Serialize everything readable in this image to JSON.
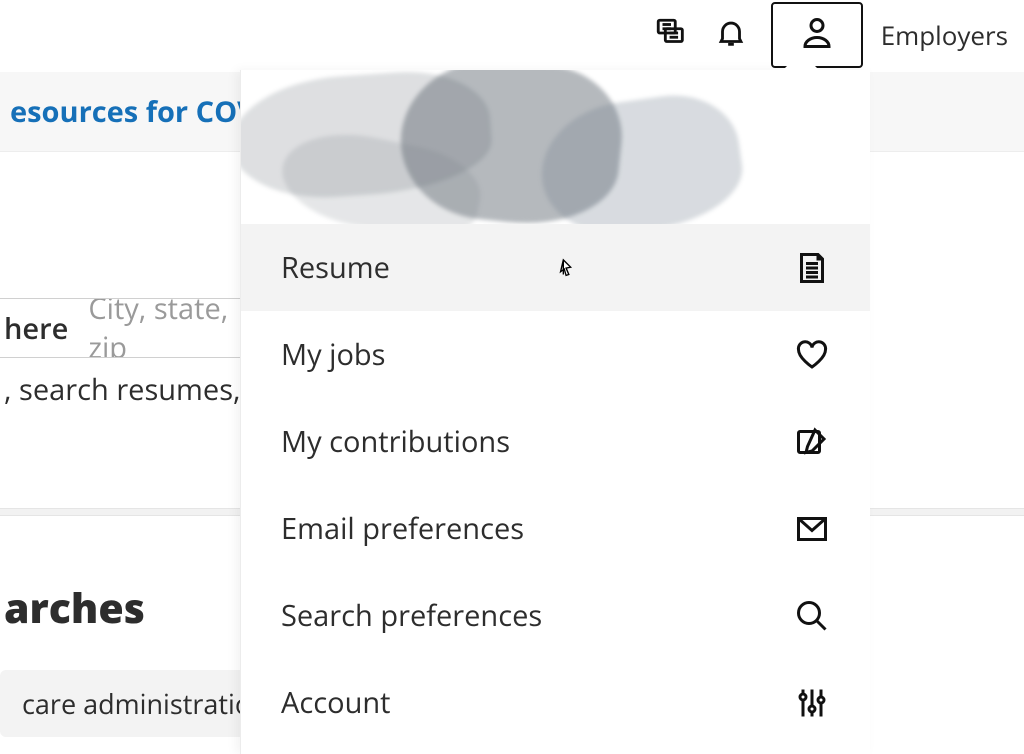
{
  "topbar": {
    "employers_link": "Employers"
  },
  "banner": {
    "covid_link_visible_text": "esources for COVID"
  },
  "search": {
    "where_label": "here",
    "where_placeholder": "City, state, zip",
    "hint_visible_text": ", search resumes, "
  },
  "saved_searches": {
    "heading_visible_text": "arches",
    "chip_visible_text": "care administration"
  },
  "dropdown": {
    "items": [
      {
        "label": "Resume",
        "icon": "document-icon"
      },
      {
        "label": "My jobs",
        "icon": "heart-icon"
      },
      {
        "label": "My contributions",
        "icon": "edit-note-icon"
      },
      {
        "label": "Email preferences",
        "icon": "envelope-icon"
      },
      {
        "label": "Search preferences",
        "icon": "search-icon"
      },
      {
        "label": "Account",
        "icon": "sliders-icon"
      }
    ]
  }
}
